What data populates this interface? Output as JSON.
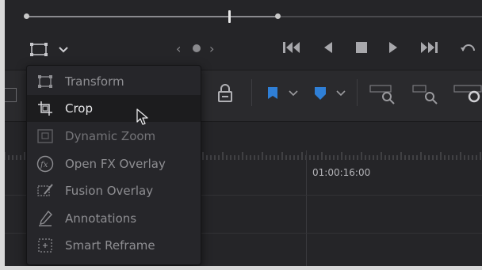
{
  "viewer": {
    "tool_icon": "transform-rect-icon",
    "tool_chevron": "chevron-down-icon"
  },
  "menu": {
    "items": [
      {
        "label": "Transform",
        "icon": "transform-icon"
      },
      {
        "label": "Crop",
        "icon": "crop-icon",
        "highlighted": true
      },
      {
        "label": "Dynamic Zoom",
        "icon": "dynamic-zoom-icon"
      },
      {
        "label": "Open FX Overlay",
        "icon": "fx-icon"
      },
      {
        "label": "Fusion Overlay",
        "icon": "fusion-overlay-icon"
      },
      {
        "label": "Annotations",
        "icon": "pen-icon"
      },
      {
        "label": "Smart Reframe",
        "icon": "smart-reframe-icon"
      }
    ]
  },
  "timeline": {
    "timecode": "01:00:16:00"
  },
  "colors": {
    "accent_blue": "#2f7fd6",
    "background": "#252528"
  }
}
